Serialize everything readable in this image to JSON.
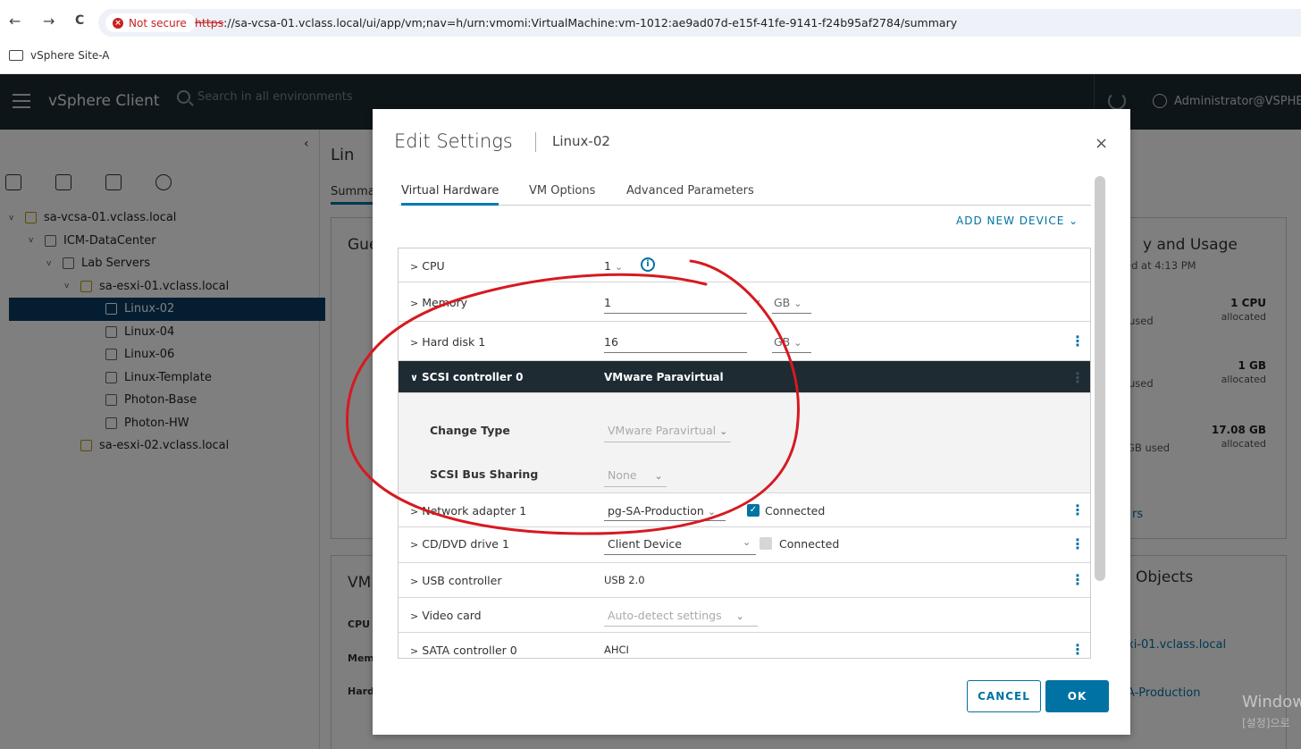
{
  "browser": {
    "back": "←",
    "forward": "→",
    "reload": "C",
    "security_label": "Not secure",
    "url_proto": "https",
    "url_rest": "://sa-vcsa-01.vclass.local/ui/app/vm;nav=h/urn:vmomi:VirtualMachine:vm-1012:ae9ad07d-e15f-41fe-9141-f24b95af2784/summary",
    "bookmark": "vSphere Site-A"
  },
  "header": {
    "app_title": "vSphere Client",
    "search_placeholder": "Search in all environments",
    "user": "Administrator@VSPHERE.LOCAL"
  },
  "sidebar": {
    "collapse": "‹",
    "tree": [
      {
        "label": "sa-vcsa-01.vclass.local",
        "twisty": "v"
      },
      {
        "label": "ICM-DataCenter",
        "twisty": "v"
      },
      {
        "label": "Lab Servers",
        "twisty": "v"
      },
      {
        "label": "sa-esxi-01.vclass.local",
        "twisty": "v"
      },
      {
        "label": "Linux-02",
        "twisty": ""
      },
      {
        "label": "Linux-04",
        "twisty": ""
      },
      {
        "label": "Linux-06",
        "twisty": ""
      },
      {
        "label": "Linux-Template",
        "twisty": ""
      },
      {
        "label": "Photon-Base",
        "twisty": ""
      },
      {
        "label": "Photon-HW",
        "twisty": ""
      },
      {
        "label": "sa-esxi-02.vclass.local",
        "twisty": ""
      }
    ]
  },
  "background": {
    "vm_title": "Lin",
    "summary_tab": "Summa",
    "guest_card_title": "Gue",
    "vm_card_title": "VM",
    "vm_rows": [
      "CPU",
      "Memo",
      "Hard"
    ],
    "capacity_title": "y and Usage",
    "capacity_updated": "ed at 4:13 PM",
    "cpu_value": "1 CPU",
    "cpu_label": "allocated",
    "cpu_used": "used",
    "mem_value": "1 GB",
    "mem_label": "allocated",
    "mem_used": "used",
    "disk_value": "17.08 GB",
    "disk_label": "allocated",
    "disk_used": "GB used",
    "link_fragment": "rs",
    "objects_title": "Objects",
    "host_link": "xi-01.vclass.local",
    "network_link": "A-Production",
    "watermark1": "Windows",
    "watermark2": "[설정]으로"
  },
  "modal": {
    "title": "Edit Settings",
    "subtitle": "Linux-02",
    "close": "×",
    "tabs": [
      "Virtual Hardware",
      "VM Options",
      "Advanced Parameters"
    ],
    "add_new_device": "ADD NEW DEVICE",
    "add_chevron": "⌄",
    "rows": {
      "cpu": {
        "label": "CPU",
        "value": "1"
      },
      "memory": {
        "label": "Memory",
        "value": "1",
        "unit": "GB"
      },
      "hard_disk": {
        "label": "Hard disk 1",
        "value": "16",
        "unit": "GB"
      },
      "scsi": {
        "label": "SCSI controller 0",
        "value": "VMware Paravirtual"
      },
      "change_type": {
        "label": "Change Type",
        "value": "VMware Paravirtual"
      },
      "bus_sharing": {
        "label": "SCSI Bus Sharing",
        "value": "None"
      },
      "network": {
        "label": "Network adapter 1",
        "value": "pg-SA-Production",
        "connected": "Connected",
        "connected_checked": true
      },
      "cddvd": {
        "label": "CD/DVD drive 1",
        "value": "Client Device",
        "connected": "Connected",
        "connected_checked": false
      },
      "usb": {
        "label": "USB controller",
        "value": "USB 2.0"
      },
      "video": {
        "label": "Video card",
        "value": "Auto-detect settings"
      },
      "sata": {
        "label": "SATA controller 0",
        "value": "AHCI"
      }
    },
    "cancel": "CANCEL",
    "ok": "OK"
  },
  "colors": {
    "accent": "#0072a3",
    "header_bg": "#1d2a33",
    "selected_row": "#0b3b61",
    "annotation": "#d71920"
  }
}
